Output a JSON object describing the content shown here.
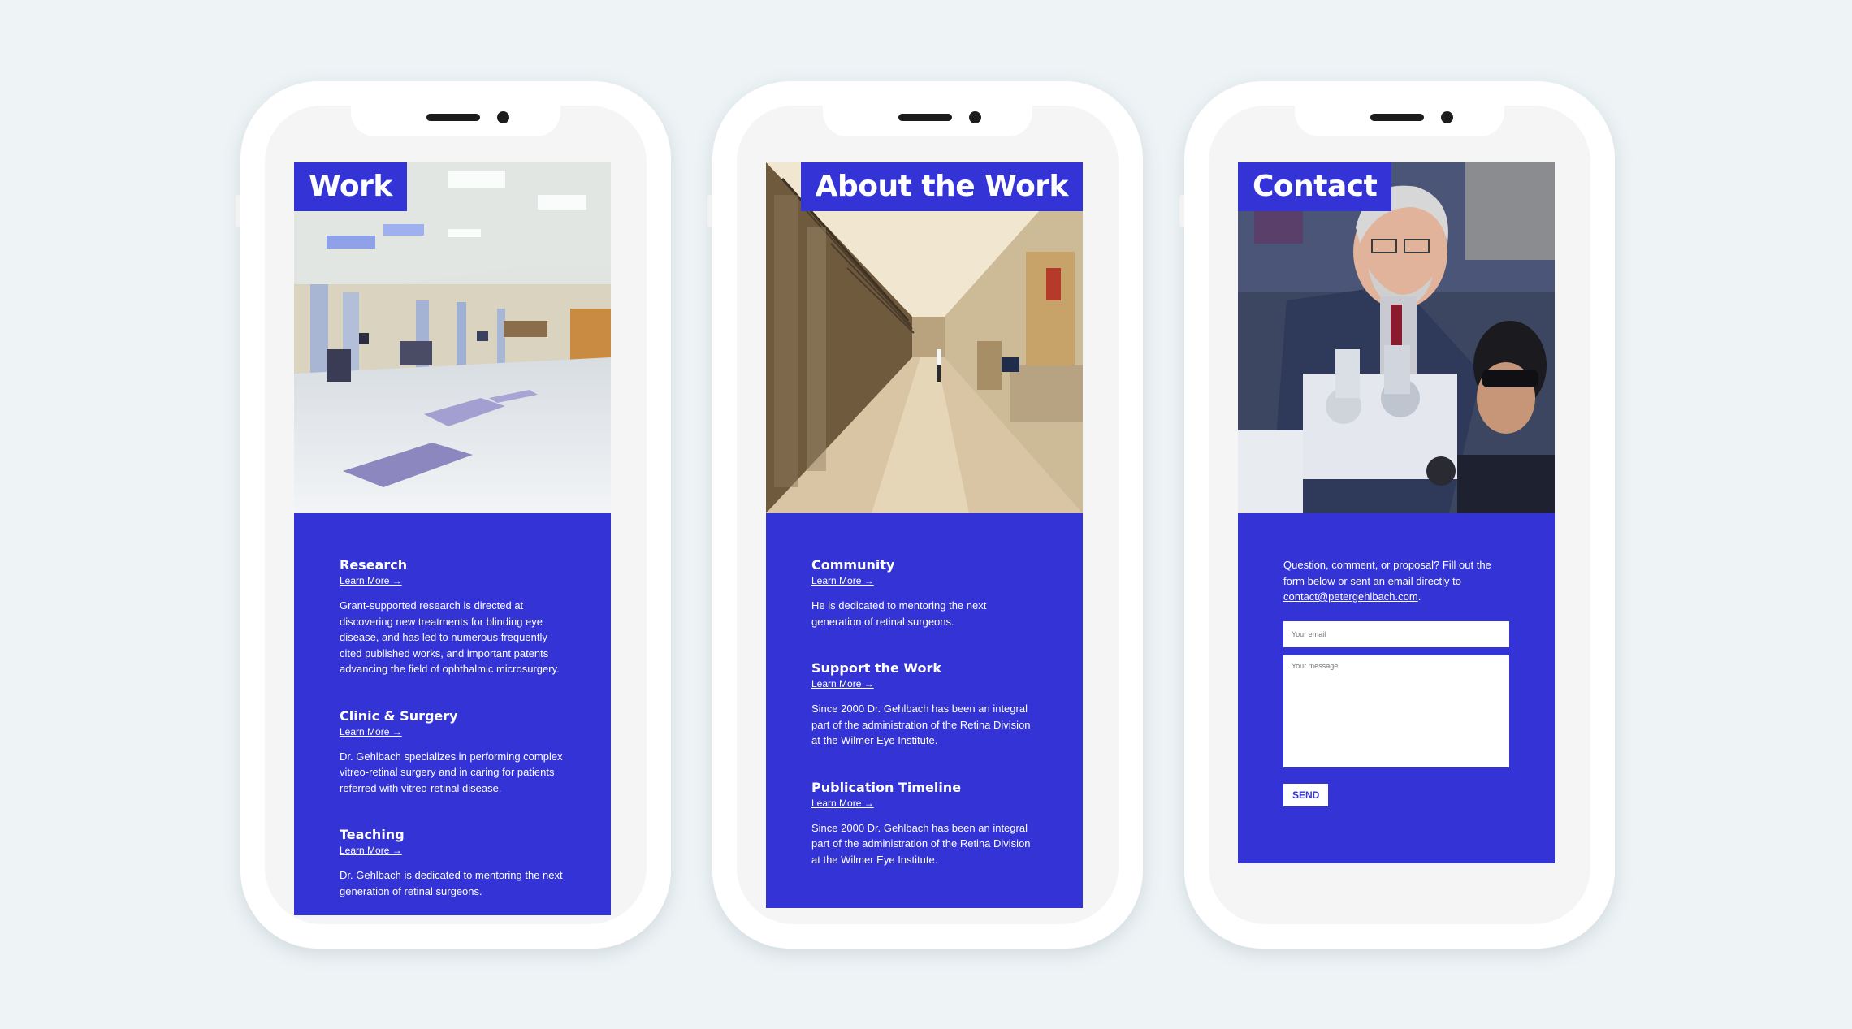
{
  "colors": {
    "accent": "#3333d6",
    "background": "#eef4f6",
    "phone": "#ffffff"
  },
  "work": {
    "title": "Work",
    "sections": [
      {
        "title": "Research",
        "link": "Learn More →",
        "text": "Grant-supported research is directed at discovering new treatments for blinding eye disease, and has led to numerous frequently cited published works, and important patents advancing the field of ophthalmic microsurgery."
      },
      {
        "title": "Clinic & Surgery",
        "link": "Learn More →",
        "text": "Dr. Gehlbach specializes in performing complex vitreo-retinal surgery and in caring for patients referred with vitreo-retinal disease."
      },
      {
        "title": "Teaching",
        "link": "Learn More →",
        "text": "Dr. Gehlbach is dedicated to mentoring the next generation of retinal surgeons."
      }
    ]
  },
  "about": {
    "title": "About the Work",
    "sections": [
      {
        "title": "Community",
        "link": "Learn More →",
        "text": "He is dedicated to mentoring the next generation of retinal surgeons."
      },
      {
        "title": "Support the Work",
        "link": "Learn More →",
        "text": "Since 2000 Dr. Gehlbach has been an integral part of the administration of the Retina Division at the Wilmer Eye Institute."
      },
      {
        "title": "Publication Timeline",
        "link": "Learn More →",
        "text": "Since 2000 Dr. Gehlbach has been an integral part of the administration of the Retina Division at the Wilmer Eye Institute."
      }
    ]
  },
  "contact": {
    "title": "Contact",
    "intro": "Question, comment, or proposal? Fill out the form below or sent an email directly to",
    "email": "contact@petergehlbach.com",
    "email_suffix": ".",
    "email_placeholder": "Your email",
    "message_placeholder": "Your message",
    "send_label": "SEND"
  }
}
